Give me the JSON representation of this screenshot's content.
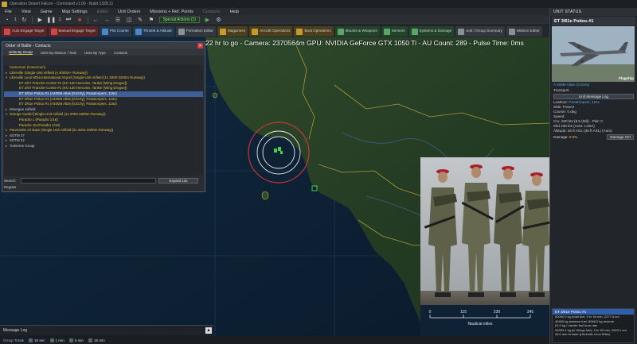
{
  "window": {
    "title": "Operation Desert Falcon - Command v1.06 - Build 1328.11"
  },
  "menu": [
    {
      "label": "File",
      "enabled": true
    },
    {
      "label": "View",
      "enabled": true
    },
    {
      "label": "Game",
      "enabled": true
    },
    {
      "label": "Map Settings",
      "enabled": true
    },
    {
      "label": "Editor",
      "enabled": false
    },
    {
      "label": "Unit Orders",
      "enabled": true
    },
    {
      "label": "Missions + Ref. Points",
      "enabled": true
    },
    {
      "label": "Contacts",
      "enabled": false
    },
    {
      "label": "Help",
      "enabled": true
    }
  ],
  "toolbar1": {
    "time_compression_1": "1",
    "time_compression_2": "1",
    "speed_label": "Special Actions (1)"
  },
  "toolbar2": [
    {
      "label": "Auto Engage Target",
      "color": "red"
    },
    {
      "label": "Manual Engage Target",
      "color": "red"
    },
    {
      "label": "Plot Course",
      "color": "blue"
    },
    {
      "label": "Throttle & Altitude",
      "color": "blue"
    },
    {
      "label": "Formation Editor",
      "color": "grey"
    },
    {
      "label": "Magazines",
      "color": "gold"
    },
    {
      "label": "Aircraft Operations",
      "color": "gold"
    },
    {
      "label": "Boat Operations",
      "color": "gold"
    },
    {
      "label": "Mounts & Weapons",
      "color": "green"
    },
    {
      "label": "Sensors",
      "color": "green"
    },
    {
      "label": "Systems & Damage",
      "color": "green"
    },
    {
      "label": "Unit / Group Summary",
      "color": "grey"
    },
    {
      "label": "Mission Editor",
      "color": "grey"
    }
  ],
  "status_overlay": "22 hr to go - Camera: 2370564m  GPU: NVIDIA GeForce GTX 1050 Ti - AU Count: 289 - Pulse Time: 0ms",
  "oob": {
    "title": "Order of Battle - Contacts",
    "tabs": [
      "Units By Group",
      "Units By Mission / Task",
      "Units By Type",
      "Contacts"
    ],
    "active_tab": "Units By Group",
    "tree": [
      {
        "text": "Cameroon (Cameroon)",
        "style": "gold",
        "indent": 0,
        "toggle": ""
      },
      {
        "text": "Libreville (Single-Unit Airfield (x 4000m+ Runway))",
        "style": "gold",
        "indent": 0,
        "toggle": "▸"
      },
      {
        "text": "Libreville Leon M'ba International Airport (Single-Unit Airfield (1x 3000-3200m Runway))",
        "style": "gold",
        "indent": 0,
        "toggle": "▾"
      },
      {
        "text": "ET 2/67 Franche-Comte #1 (KC-130 Hercules, Tanker [Wing Drogue])",
        "style": "gold",
        "indent": 2,
        "toggle": ""
      },
      {
        "text": "ET 2/67 Franche-Comte #1 (KC-130 Hercules, Tanker [Wing Drogue])",
        "style": "gold",
        "indent": 2,
        "toggle": ""
      },
      {
        "text": "ET 3/61e Poitou #1 (A400M Atlas [Grizzly], Paratroopers, 116x)",
        "style": "sel",
        "indent": 2,
        "toggle": ""
      },
      {
        "text": "ET 3/61e Poitou #1 (A400M Atlas [Grizzly], Paratroopers, 116x)",
        "style": "gold",
        "indent": 2,
        "toggle": ""
      },
      {
        "text": "ET 3/61e Poitou #1 (A400M Atlas [Grizzly], Paratroopers, 116x)",
        "style": "gold",
        "indent": 2,
        "toggle": ""
      },
      {
        "text": "Mvengue Airfield",
        "style": "normal",
        "indent": 0,
        "toggle": "▸"
      },
      {
        "text": "Orange Cardel (Single-Unit Airfield (1x 2000-2600m Runway))",
        "style": "gold",
        "indent": 0,
        "toggle": "▾"
      },
      {
        "text": "Paradro 1 (Paradro 1/18)",
        "style": "gold",
        "indent": 2,
        "toggle": ""
      },
      {
        "text": "Paradro 18 (Paradro 1/18)",
        "style": "gold",
        "indent": 2,
        "toggle": ""
      },
      {
        "text": "Pancreoite Air Base (Single-Unit Airfield (2x 3201-4000m Runway))",
        "style": "gold",
        "indent": 0,
        "toggle": "▸"
      },
      {
        "text": "SOTM 27",
        "style": "normal",
        "indent": 0,
        "toggle": "▸"
      },
      {
        "text": "SOTM 22",
        "style": "normal",
        "indent": 0,
        "toggle": "▸"
      },
      {
        "text": "Tomteme Group",
        "style": "normal",
        "indent": 0,
        "toggle": "▸"
      }
    ],
    "search_label": "Search:",
    "search_value": "",
    "expand_button": "Expand List",
    "footer_label": "Regular"
  },
  "message_log": {
    "label": "Message Log"
  },
  "bottom_bar": {
    "label": "Group Totals",
    "steps": [
      "15 sec",
      "1 min",
      "5 min",
      "15 min"
    ]
  },
  "scale_bar": {
    "ticks": [
      "0",
      "115",
      "230",
      "345"
    ],
    "label": "Nautical miles"
  },
  "unit_panel": {
    "header": "UNIT STATUS",
    "unit_name": "ET 3/61e Poitou #1",
    "flag_label": "Flagship",
    "type_link": "A 400M Atlas (Grizzly)",
    "role": "Transport",
    "message_button": "Unit Message Log",
    "loadout_label": "Loadout:",
    "loadout_value": "Paratroopers, 116x",
    "side": "Side: France",
    "course": "Course: 0 deg",
    "speed_label": "Speed:",
    "speed_lines": [
      "Cru: 230 kts (8.5 (Ml)) - Plat: 0",
      "Skd 230 kts (Auto: Loiter)"
    ],
    "altitude": "Altitude: 36 ft AGL (36 ft ASL) (Auto)",
    "damage_label": "Damage:",
    "damage_value": "0.0%",
    "damage_button": "Damage Ctrl",
    "bottom_header": "ET 3/61e Poitou #1",
    "bottom_lines": [
      "50000.0 kg (total fuel, 9 hr 54 min, 2277.5 nm",
      "40450 kg (reserve fuel, 5066.0 kg reserve",
      "61.0 kg / minute fuel burn rate",
      "40303.4 kg (in Wings fuel), 9 hr 52 min, 2043.1 nm",
      "26.0 min to base (Libreville Leon M'ba)"
    ]
  }
}
